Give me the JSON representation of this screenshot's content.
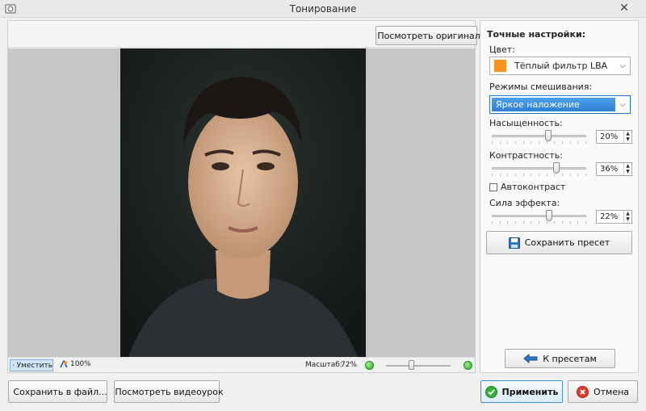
{
  "window": {
    "title": "Тонирование",
    "close_glyph": "✕"
  },
  "left": {
    "view_original_label": "Посмотреть оригинал",
    "status": {
      "fit_label": "Уместить",
      "actual_label": "100%",
      "zoom_label": "Масштаб:",
      "zoom_value": "72%",
      "zoom_fraction": 0.4
    }
  },
  "right": {
    "heading": "Точные настройки:",
    "color_label": "Цвет:",
    "color_value": "Тёплый фильтр LBA",
    "color_swatch": "#f7941d",
    "blend_label": "Режимы смешивания:",
    "blend_value": "Яркое наложение",
    "saturation": {
      "label": "Насыщенность:",
      "value": "20%",
      "fraction": 0.6
    },
    "contrast": {
      "label": "Контрастность:",
      "value": "36%",
      "fraction": 0.68
    },
    "autocontrast_label": "Автоконтраст",
    "autocontrast_checked": false,
    "strength": {
      "label": "Сила эффекта:",
      "value": "22%",
      "fraction": 0.61
    },
    "save_preset_label": "Сохранить пресет",
    "to_presets_label": "К пресетам"
  },
  "footer": {
    "save_file_label": "Сохранить в файл...",
    "watch_video_label": "Посмотреть видеоурок",
    "apply_label": "Применить",
    "cancel_label": "Отмена"
  },
  "icons": [
    "app-icon",
    "eye-icon",
    "fit-icon",
    "zoom-100-icon",
    "save-icon",
    "arrow-left-icon",
    "webcam-icon",
    "check-icon",
    "cancel-icon"
  ]
}
